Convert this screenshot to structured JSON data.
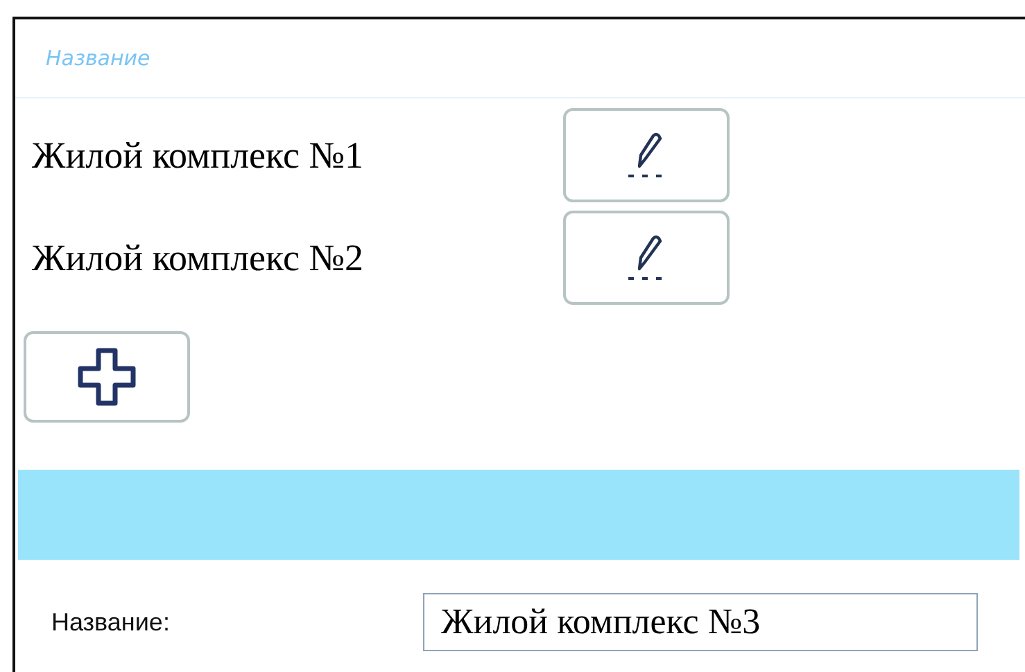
{
  "header": {
    "title": "Название"
  },
  "items": [
    {
      "name": "Жилой комплекс №1"
    },
    {
      "name": "Жилой комплекс №2"
    }
  ],
  "form": {
    "label": "Название:",
    "value": "Жилой комплекс №3"
  }
}
